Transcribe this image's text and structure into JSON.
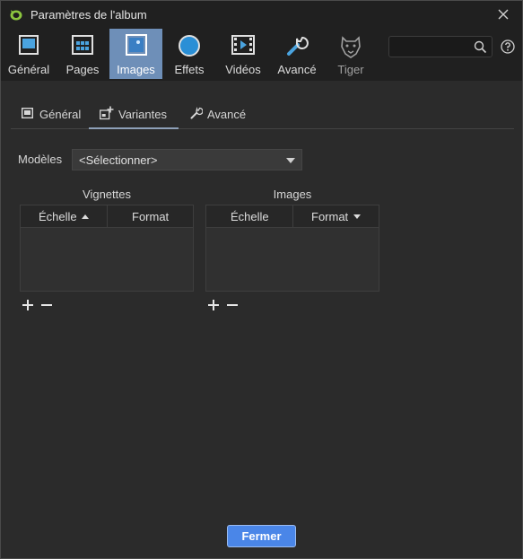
{
  "window": {
    "title": "Paramètres de l'album"
  },
  "toolbar": {
    "items": [
      {
        "label": "Général"
      },
      {
        "label": "Pages"
      },
      {
        "label": "Images"
      },
      {
        "label": "Effets"
      },
      {
        "label": "Vidéos"
      },
      {
        "label": "Avancé"
      },
      {
        "label": "Tiger"
      }
    ],
    "active": "Images"
  },
  "search": {
    "value": "",
    "placeholder": ""
  },
  "subtabs": {
    "items": [
      {
        "label": "Général"
      },
      {
        "label": "Variantes"
      },
      {
        "label": "Avancé"
      }
    ],
    "active": "Variantes"
  },
  "models": {
    "label": "Modèles",
    "selected": "<Sélectionner>"
  },
  "thumbnails": {
    "title": "Vignettes",
    "col_scale": "Échelle",
    "col_format": "Format"
  },
  "images": {
    "title": "Images",
    "col_scale": "Échelle",
    "col_format": "Format"
  },
  "footer": {
    "close_label": "Fermer"
  },
  "colors": {
    "accent": "#4a86e8",
    "active_tab": "#6e8fb8",
    "background": "#2b2b2b"
  }
}
